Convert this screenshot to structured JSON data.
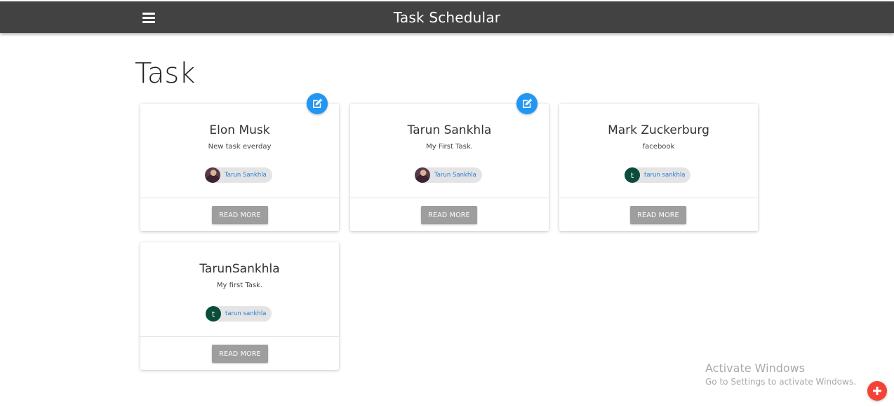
{
  "header": {
    "title": "Task Schedular",
    "menu_icon": "menu-icon"
  },
  "page": {
    "title": "Task"
  },
  "tasks": [
    {
      "name": "Elon Musk",
      "description": "New task everday",
      "assignee": "Tarun Sankhla",
      "avatar": "photo",
      "editable": true,
      "button": "READ MORE"
    },
    {
      "name": "Tarun Sankhla",
      "description": "My First Task.",
      "assignee": "Tarun Sankhla",
      "avatar": "photo",
      "editable": true,
      "button": "READ MORE"
    },
    {
      "name": "Mark Zuckerburg",
      "description": "facebook",
      "assignee": "tarun sankhla",
      "avatar": "letter",
      "avatar_letter": "t",
      "editable": false,
      "button": "READ MORE"
    },
    {
      "name": "TarunSankhla",
      "description": "My first Task.",
      "assignee": "tarun sankhla",
      "avatar": "letter",
      "avatar_letter": "t",
      "editable": false,
      "button": "READ MORE"
    }
  ],
  "watermark": {
    "title": "Activate Windows",
    "subtitle": "Go to Settings to activate Windows."
  },
  "fab": {
    "icon": "plus-icon"
  },
  "colors": {
    "topbar": "#424242",
    "edit": "#2196f3",
    "add": "#f44336",
    "button": "#9e9e9e",
    "chip_text": "#2b7fd0"
  }
}
